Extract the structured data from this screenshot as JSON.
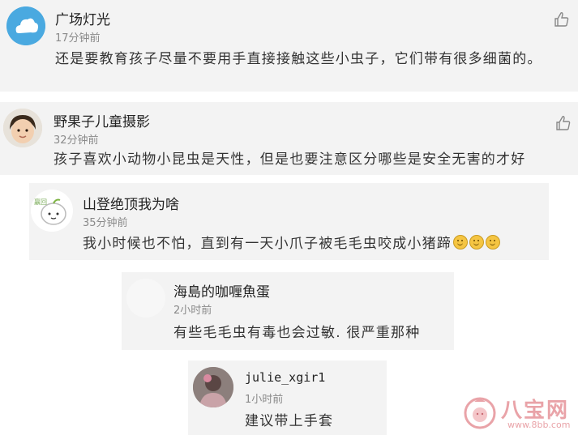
{
  "comments": [
    {
      "name": "广场灯光",
      "time": "17分钟前",
      "text": "还是要教育孩子尽量不要用手直接接触这些小虫子，它们带有很多细菌的。",
      "avatar_icon": "cloud-avatar-icon",
      "like_icon": "thumbs-up-icon"
    },
    {
      "name": "野果子儿童摄影",
      "time": "32分钟前",
      "text": "孩子喜欢小动物小昆虫是天性，但是也要注意区分哪些是安全无害的才好",
      "avatar_icon": "child-photo-avatar",
      "like_icon": "thumbs-up-icon"
    },
    {
      "name": "山登绝顶我为啥",
      "time": "35分钟前",
      "text": "我小时候也不怕，直到有一天小爪子被毛毛虫咬成小猪蹄",
      "avatar_icon": "cartoon-avatar-icon",
      "emoji_icon": "smile-emoji-icon"
    },
    {
      "name": "海島的咖喱魚蛋",
      "time": "2小时前",
      "text": "有些毛毛虫有毒也会过敏. 很严重那种",
      "avatar_icon": "blank-avatar-icon"
    },
    {
      "name": "julie_xgir1",
      "time": "1小时前",
      "text": "建议带上手套",
      "avatar_icon": "photo-avatar-icon"
    }
  ],
  "watermark": {
    "brand": "八宝网",
    "url": "www.8bb.com",
    "logo_icon": "baby-logo-icon",
    "color": "#e9a3a8"
  }
}
